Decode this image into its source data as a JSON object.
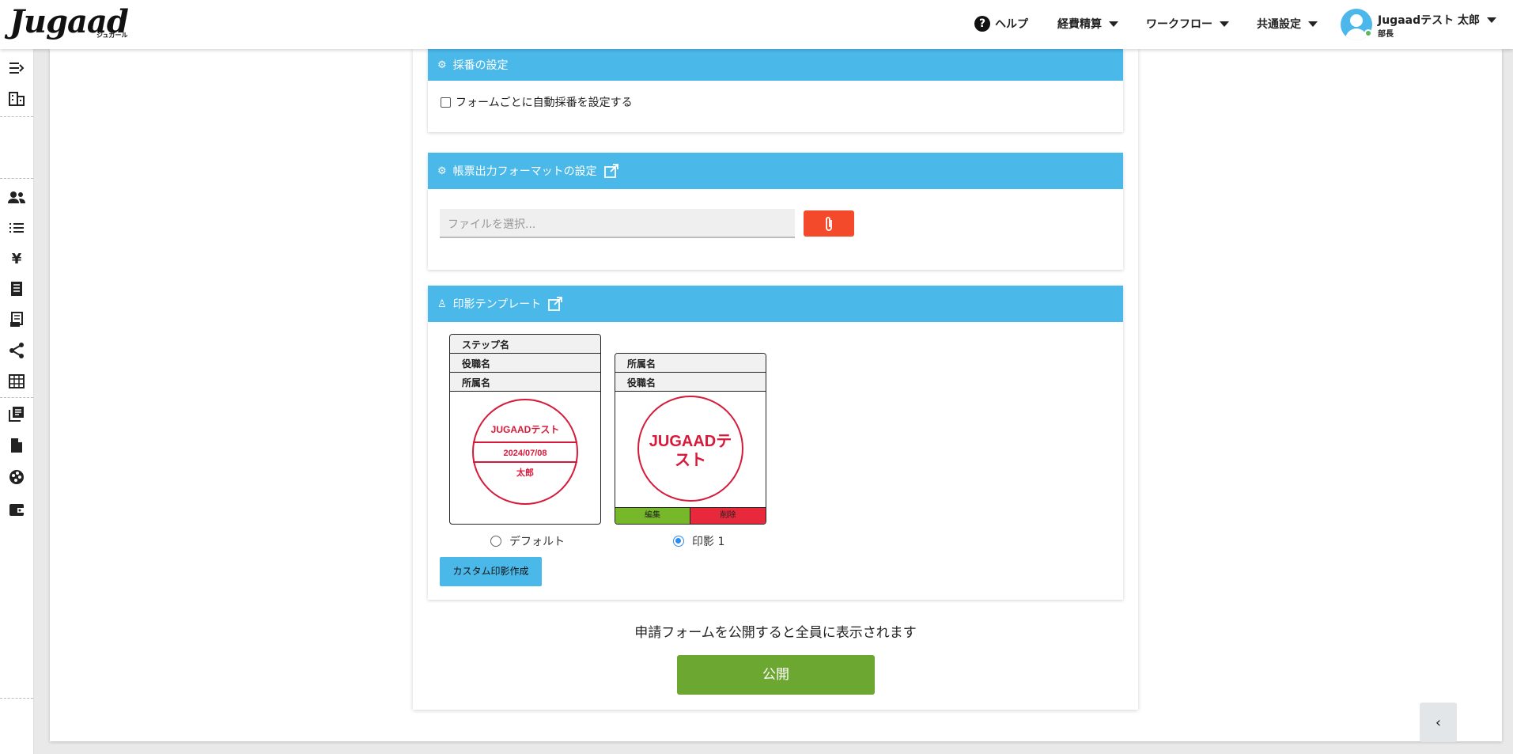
{
  "header": {
    "logo": "Jugaad",
    "logo_sub": "ジュガール",
    "help_label": "ヘルプ",
    "menu_expense": "経費精算",
    "menu_workflow": "ワークフロー",
    "menu_common": "共通設定",
    "user_name": "Jugaadテスト 太郎",
    "user_role": "部長"
  },
  "sidebar": {
    "icons": [
      "menu-collapse-icon",
      "building-icon",
      "users-icon",
      "list-icon",
      "yen-icon",
      "receipt-icon",
      "ledger-icon",
      "share-icon",
      "grid-icon",
      "library-icon",
      "document-icon",
      "palette-icon",
      "wallet-icon"
    ]
  },
  "numbering": {
    "title": "採番の設定",
    "checkbox_label": "フォームごとに自動採番を設定する"
  },
  "format": {
    "title": "帳票出力フォーマットの設定",
    "file_placeholder": "ファイルを選択..."
  },
  "stamp": {
    "title": "印影テンプレート",
    "default_card": {
      "rows": [
        "ステップ名",
        "役職名",
        "所属名"
      ],
      "seal_top": "JUGAADテスト",
      "seal_date": "2024/07/08",
      "seal_name": "太郎",
      "radio_label": "デフォルト"
    },
    "custom_card": {
      "rows": [
        "所属名",
        "役職名"
      ],
      "seal_text_line1": "JUGAADテ",
      "seal_text_line2": "スト",
      "edit_label": "編集",
      "delete_label": "削除",
      "radio_label": "印影 1"
    },
    "custom_button": "カスタム印影作成"
  },
  "publish": {
    "note": "申請フォームを公開すると全員に表示されます",
    "button": "公開"
  },
  "collapse_label": "‹",
  "colors": {
    "header_bar": "#4ab9ea",
    "publish": "#6ca731",
    "clip": "#f34a2b",
    "seal": "#d7193a"
  }
}
